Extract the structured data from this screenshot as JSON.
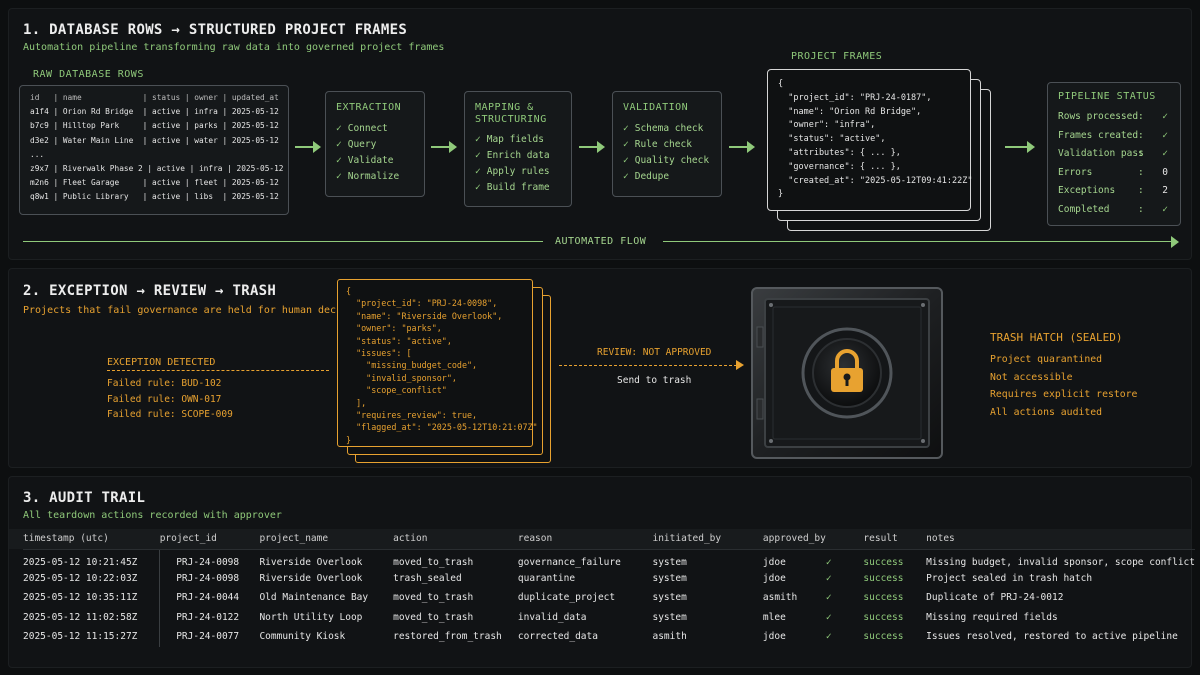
{
  "section1": {
    "title": "1. DATABASE ROWS → STRUCTURED PROJECT FRAMES",
    "subtitle": "Automation pipeline transforming raw data into governed project frames",
    "raw_label": "RAW DATABASE ROWS",
    "raw_rows": [
      "id   | name             | status | owner | updated_at",
      "a1f4 | Orion Rd Bridge  | active | infra | 2025-05-12",
      "b7c9 | Hilltop Park     | active | parks | 2025-05-12",
      "d3e2 | Water Main Line  | active | water | 2025-05-12",
      "...",
      "z9x7 | Riverwalk Phase 2 | active | infra | 2025-05-12",
      "m2n6 | Fleet Garage     | active | fleet | 2025-05-12",
      "q8w1 | Public Library   | active | libs  | 2025-05-12"
    ],
    "stages": [
      {
        "title": "EXTRACTION",
        "items": [
          "Connect",
          "Query",
          "Validate",
          "Normalize"
        ]
      },
      {
        "title": "MAPPING &\nSTRUCTURING",
        "items": [
          "Map fields",
          "Enrich data",
          "Apply rules",
          "Build frame"
        ]
      },
      {
        "title": "VALIDATION",
        "items": [
          "Schema check",
          "Rule check",
          "Quality check",
          "Dedupe"
        ]
      }
    ],
    "frames_label": "PROJECT FRAMES",
    "frame_json": "{\n  \"project_id\": \"PRJ-24-0187\",\n  \"name\": \"Orion Rd Bridge\",\n  \"owner\": \"infra\",\n  \"status\": \"active\",\n  \"attributes\": { ... },\n  \"governance\": { ... },\n  \"created_at\": \"2025-05-12T09:41:22Z\"\n}",
    "status_title": "PIPELINE STATUS",
    "status_rows": [
      {
        "k": "Rows processed",
        "v": "✓"
      },
      {
        "k": "Frames created",
        "v": "✓"
      },
      {
        "k": "Validation pass",
        "v": "✓"
      },
      {
        "k": "Errors",
        "v": "0"
      },
      {
        "k": "Exceptions",
        "v": "2"
      },
      {
        "k": "Completed",
        "v": "✓"
      }
    ],
    "flow_label": "AUTOMATED FLOW"
  },
  "section2": {
    "title": "2. EXCEPTION → REVIEW → TRASH",
    "subtitle": "Projects that fail governance are held for human decision",
    "exception_title": "EXCEPTION DETECTED",
    "failed_rules": [
      "Failed rule: BUD-102",
      "Failed rule: OWN-017",
      "Failed rule: SCOPE-009"
    ],
    "exception_json": "{\n  \"project_id\": \"PRJ-24-0098\",\n  \"name\": \"Riverside Overlook\",\n  \"owner\": \"parks\",\n  \"status\": \"active\",\n  \"issues\": [\n    \"missing_budget_code\",\n    \"invalid_sponsor\",\n    \"scope_conflict\"\n  ],\n  \"requires_review\": true,\n  \"flagged_at\": \"2025-05-12T10:21:07Z\"\n}",
    "review_label": "REVIEW: NOT APPROVED",
    "send_label": "Send to trash",
    "hatch_title": "TRASH HATCH (SEALED)",
    "hatch_items": [
      "Project quarantined",
      "Not accessible",
      "Requires explicit restore",
      "All actions audited"
    ]
  },
  "section3": {
    "title": "3. AUDIT TRAIL",
    "subtitle": "All teardown actions recorded with approver",
    "columns": [
      "timestamp (utc)",
      "project_id",
      "project_name",
      "action",
      "reason",
      "initiated_by",
      "approved_by",
      "",
      "result",
      "notes"
    ],
    "rows": [
      [
        "2025-05-12 10:21:45Z",
        "PRJ-24-0098",
        "Riverside Overlook",
        "moved_to_trash",
        "governance_failure",
        "system",
        "jdoe",
        "✓",
        "success",
        "Missing budget, invalid sponsor, scope conflict"
      ],
      [
        "2025-05-12 10:22:03Z",
        "PRJ-24-0098",
        "Riverside Overlook",
        "trash_sealed",
        "quarantine",
        "system",
        "jdoe",
        "✓",
        "success",
        "Project sealed in trash hatch"
      ],
      [
        "2025-05-12 10:35:11Z",
        "PRJ-24-0044",
        "Old Maintenance Bay",
        "moved_to_trash",
        "duplicate_project",
        "system",
        "asmith",
        "✓",
        "success",
        "Duplicate of PRJ-24-0012"
      ],
      [
        "2025-05-12 11:02:58Z",
        "PRJ-24-0122",
        "North Utility Loop",
        "moved_to_trash",
        "invalid_data",
        "system",
        "mlee",
        "✓",
        "success",
        "Missing required fields"
      ],
      [
        "2025-05-12 11:15:27Z",
        "PRJ-24-0077",
        "Community Kiosk",
        "restored_from_trash",
        "corrected_data",
        "asmith",
        "jdoe",
        "✓",
        "success",
        "Issues resolved, restored to active pipeline"
      ]
    ]
  },
  "colors": {
    "accent_green": "#8fc97a",
    "accent_orange": "#e8a230",
    "background": "#0d0f10"
  }
}
